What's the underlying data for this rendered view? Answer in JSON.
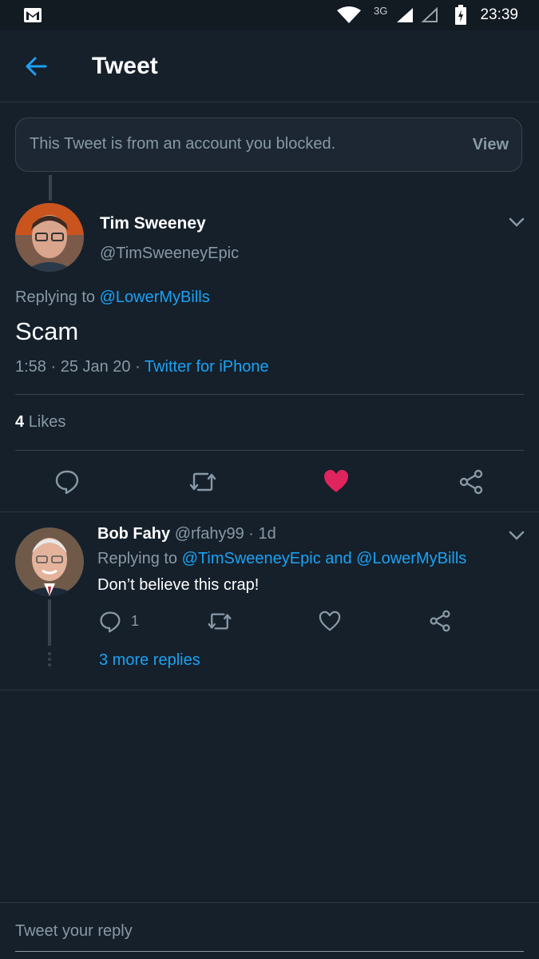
{
  "status_bar": {
    "time": "23:39",
    "network": "3G"
  },
  "header": {
    "title": "Tweet"
  },
  "blocked_banner": {
    "text": "This Tweet is from an account you blocked.",
    "action": "View"
  },
  "main_tweet": {
    "name": "Tim Sweeney",
    "handle": "@TimSweeneyEpic",
    "replying_prefix": "Replying to",
    "replying_to": "@LowerMyBills",
    "text": "Scam",
    "meta_time": "1:58 · 25 Jan 20 ·",
    "source": "Twitter for iPhone",
    "likes_count": "4",
    "likes_label": "Likes",
    "liked": true,
    "colors": {
      "like": "#e0245e",
      "link": "#1da1f2"
    }
  },
  "reply": {
    "name": "Bob Fahy",
    "handle_time": "@rfahy99 · 1d",
    "replying_prefix": "Replying to",
    "replying_to": "@TimSweeneyEpic and @LowerMyBills",
    "text": "Don’t believe this crap!",
    "reply_count": "1",
    "more_replies": "3 more replies"
  },
  "compose": {
    "placeholder": "Tweet your reply"
  }
}
